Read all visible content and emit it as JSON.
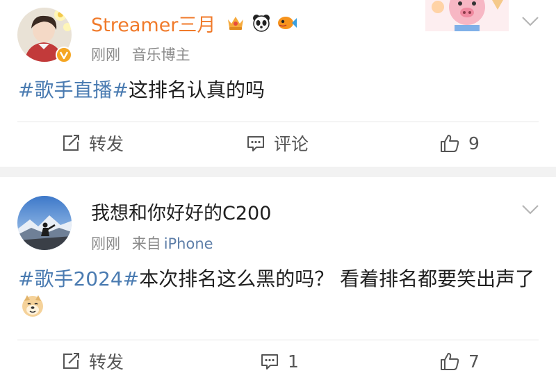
{
  "posts": [
    {
      "user": {
        "name": "Streamer三月",
        "avatar": "avatar-woman"
      },
      "time": "刚刚",
      "badge": "音乐博主",
      "text_topic": "#歌手直播#",
      "text_body": "这排名认真的吗",
      "actions": {
        "repost": "转发",
        "comment": "评论",
        "like": "9"
      }
    },
    {
      "user": {
        "name": "我想和你好好的C200",
        "avatar": "avatar-mountain"
      },
      "time": "刚刚",
      "source_prefix": "来自",
      "source": "iPhone",
      "text_topic": "#歌手2024#",
      "text_body": "本次排名这么黑的吗？ 看着排名都要笑出声了",
      "actions": {
        "repost": "转发",
        "comment": "1",
        "like": "7"
      }
    }
  ],
  "icons": [
    "verified-icon",
    "crown-icon",
    "panda-icon",
    "fish-icon",
    "pig-sticker-icon",
    "chevron-down-icon",
    "repost-icon",
    "comment-icon",
    "like-icon",
    "doge-emoji-icon"
  ],
  "colors": {
    "username": "#f07a2a",
    "topic": "#4a7bb1",
    "meta": "#8a8a8a",
    "separator": "#f2f2f2"
  }
}
